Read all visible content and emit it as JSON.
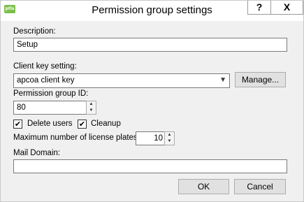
{
  "window": {
    "title": "Permission group settings",
    "help_label": "?",
    "close_label": "X",
    "icon_text": "ptls"
  },
  "description": {
    "label": "Description:",
    "value": "Setup"
  },
  "client_key": {
    "label": "Client key setting:",
    "value": "apcoa client key",
    "manage_label": "Manage..."
  },
  "permission_group": {
    "label": "Permission group ID:",
    "value": "80"
  },
  "options": {
    "delete_users_label": "Delete users",
    "delete_users_checked": true,
    "cleanup_label": "Cleanup",
    "cleanup_checked": true
  },
  "max_plates": {
    "label": "Maximum number of license plates:",
    "value": "10"
  },
  "mail_domain": {
    "label": "Mail Domain:",
    "value": ""
  },
  "buttons": {
    "ok_label": "OK",
    "cancel_label": "Cancel"
  }
}
